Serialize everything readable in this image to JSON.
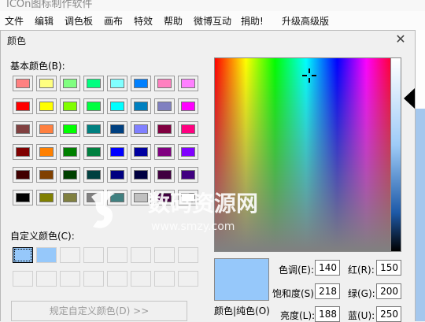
{
  "app": {
    "title": "ICOn图标制作软件",
    "menu": [
      "文件",
      "编辑",
      "调色板",
      "画布",
      "特效",
      "帮助",
      "微博互动",
      "捐助!",
      "升级高级版"
    ]
  },
  "dialog": {
    "title": "颜色",
    "basic_colors_label": "基本颜色(B):",
    "basic_colors": [
      [
        "#ff8080",
        "#ffff80",
        "#80ff80",
        "#00ff80",
        "#80ffff",
        "#0080ff",
        "#ff80c0",
        "#ff80ff"
      ],
      [
        "#ff0000",
        "#ffff00",
        "#80ff00",
        "#00ff40",
        "#00ffff",
        "#0080c0",
        "#8080c0",
        "#ff00ff"
      ],
      [
        "#804040",
        "#ff8040",
        "#00ff00",
        "#008080",
        "#004080",
        "#8080ff",
        "#800040",
        "#ff0080"
      ],
      [
        "#800000",
        "#ff8000",
        "#008000",
        "#008040",
        "#0000ff",
        "#0000a0",
        "#800080",
        "#8000ff"
      ],
      [
        "#400000",
        "#804000",
        "#004000",
        "#004040",
        "#000080",
        "#000040",
        "#400040",
        "#400080"
      ],
      [
        "#000000",
        "#808000",
        "#808040",
        "#808080",
        "#408080",
        "#c0c0c0",
        "#400040",
        "#ffffff"
      ]
    ],
    "custom_colors_label": "自定义颜色(C):",
    "custom_colors": [
      "#96c8fa",
      "#96c8fa",
      "",
      "",
      "",
      "",
      "",
      "",
      "",
      "",
      "",
      "",
      "",
      "",
      "",
      ""
    ],
    "define_custom_button": "规定自定义颜色(D) >>",
    "color_solid_label": "颜色|纯色(O)",
    "current_color": "#96c8fa",
    "fields": {
      "hue_label": "色调(E):",
      "hue": "140",
      "sat_label": "饱和度(S):",
      "sat": "218",
      "lum_label": "亮度(L):",
      "lum": "188",
      "red_label": "红(R):",
      "red": "150",
      "green_label": "绿(G):",
      "green": "200",
      "blue_label": "蓝(U):",
      "blue": "250"
    }
  },
  "watermark": {
    "text": "数码资源网",
    "url": "www.smzy.com"
  }
}
